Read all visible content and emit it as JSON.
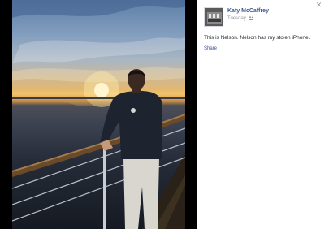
{
  "post": {
    "author_name": "Katy McCaffrey",
    "timestamp": "Tuesday",
    "audience_icon": "people-icon",
    "caption": "This is Nelson. Nelson has my stolen iPhone.",
    "share_label": "Share"
  },
  "viewer": {
    "close_icon": "close-icon",
    "close_glyph": "✕"
  },
  "photo": {
    "subject": "man-at-ship-railing-at-sunset"
  },
  "colors": {
    "link": "#3b5998",
    "meta_text": "#90949c",
    "caption_text": "#1d2129",
    "backdrop": "#000000",
    "panel": "#ffffff"
  }
}
